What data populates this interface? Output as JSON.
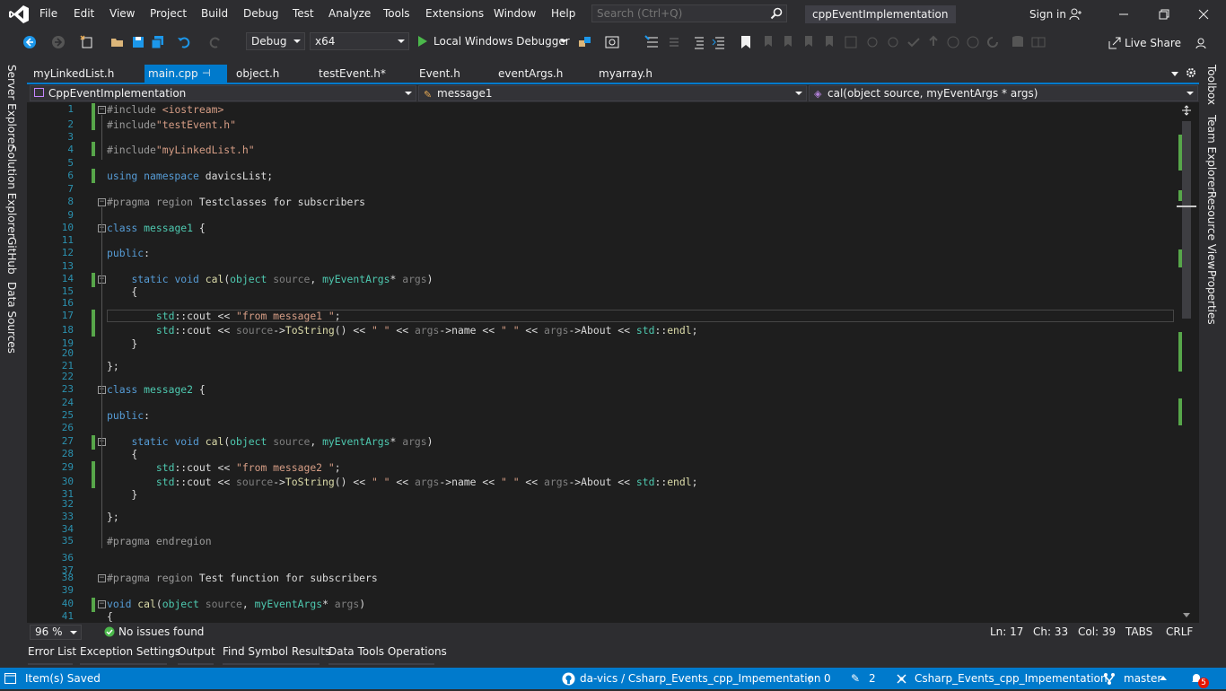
{
  "menu": {
    "items": [
      "File",
      "Edit",
      "View",
      "Project",
      "Build",
      "Debug",
      "Test",
      "Analyze",
      "Tools",
      "Extensions",
      "Window",
      "Help"
    ],
    "search_placeholder": "Search (Ctrl+Q)",
    "solution_title": "cppEventImplementation",
    "signin_label": "Sign in"
  },
  "toolbar": {
    "config": "Debug",
    "platform": "x64",
    "debugger_label": "Local Windows Debugger",
    "liveshare_label": "Live Share"
  },
  "left_side_tabs": [
    "Server Explorer",
    "Solution Explorer",
    "GitHub",
    "Data Sources"
  ],
  "right_side_tabs": [
    "Toolbox",
    "Team Explorer",
    "Resource View",
    "Properties"
  ],
  "doc_tabs": [
    "myLinkedList.h",
    "main.cpp",
    "object.h",
    "testEvent.h*",
    "Event.h",
    "eventArgs.h",
    "myarray.h"
  ],
  "nav": {
    "project": "CppEventImplementation",
    "scope": "message1",
    "member": "cal(object source, myEventArgs * args)"
  },
  "editor": {
    "line_numbers": [
      "1",
      "2",
      "3",
      "4",
      "5",
      "6",
      "7",
      "8",
      "9",
      "10",
      "11",
      "12",
      "13",
      "14",
      "15",
      "16",
      "17",
      "18",
      "19",
      "20",
      "21",
      "22",
      "23",
      "24",
      "25",
      "26",
      "27",
      "28",
      "29",
      "30",
      "31",
      "32",
      "33",
      "34",
      "35",
      "36",
      "37",
      "38",
      "39",
      "40",
      "41"
    ]
  },
  "editor_status": {
    "zoom": "96 %",
    "issues": "No issues found",
    "line": "Ln: 17",
    "ch": "Ch: 33",
    "col": "Col: 39",
    "tabs": "TABS",
    "eol": "CRLF"
  },
  "tool_tabs": [
    "Error List",
    "Exception Settings",
    "Output",
    "Find Symbol Results",
    "Data Tools Operations"
  ],
  "statusbar": {
    "message": "Item(s) Saved",
    "repo": "da-vics / Csharp_Events_cpp_Impementation",
    "push_count": "0",
    "changes_count": "2",
    "repo_name": "Csharp_Events_cpp_Impementation",
    "branch": "master",
    "notifications": "5"
  },
  "colors": {
    "accent": "#007acc",
    "change_marker": "#57a64a",
    "keyword": "#569cd6",
    "string": "#d69d85",
    "type": "#4ec9b0"
  }
}
